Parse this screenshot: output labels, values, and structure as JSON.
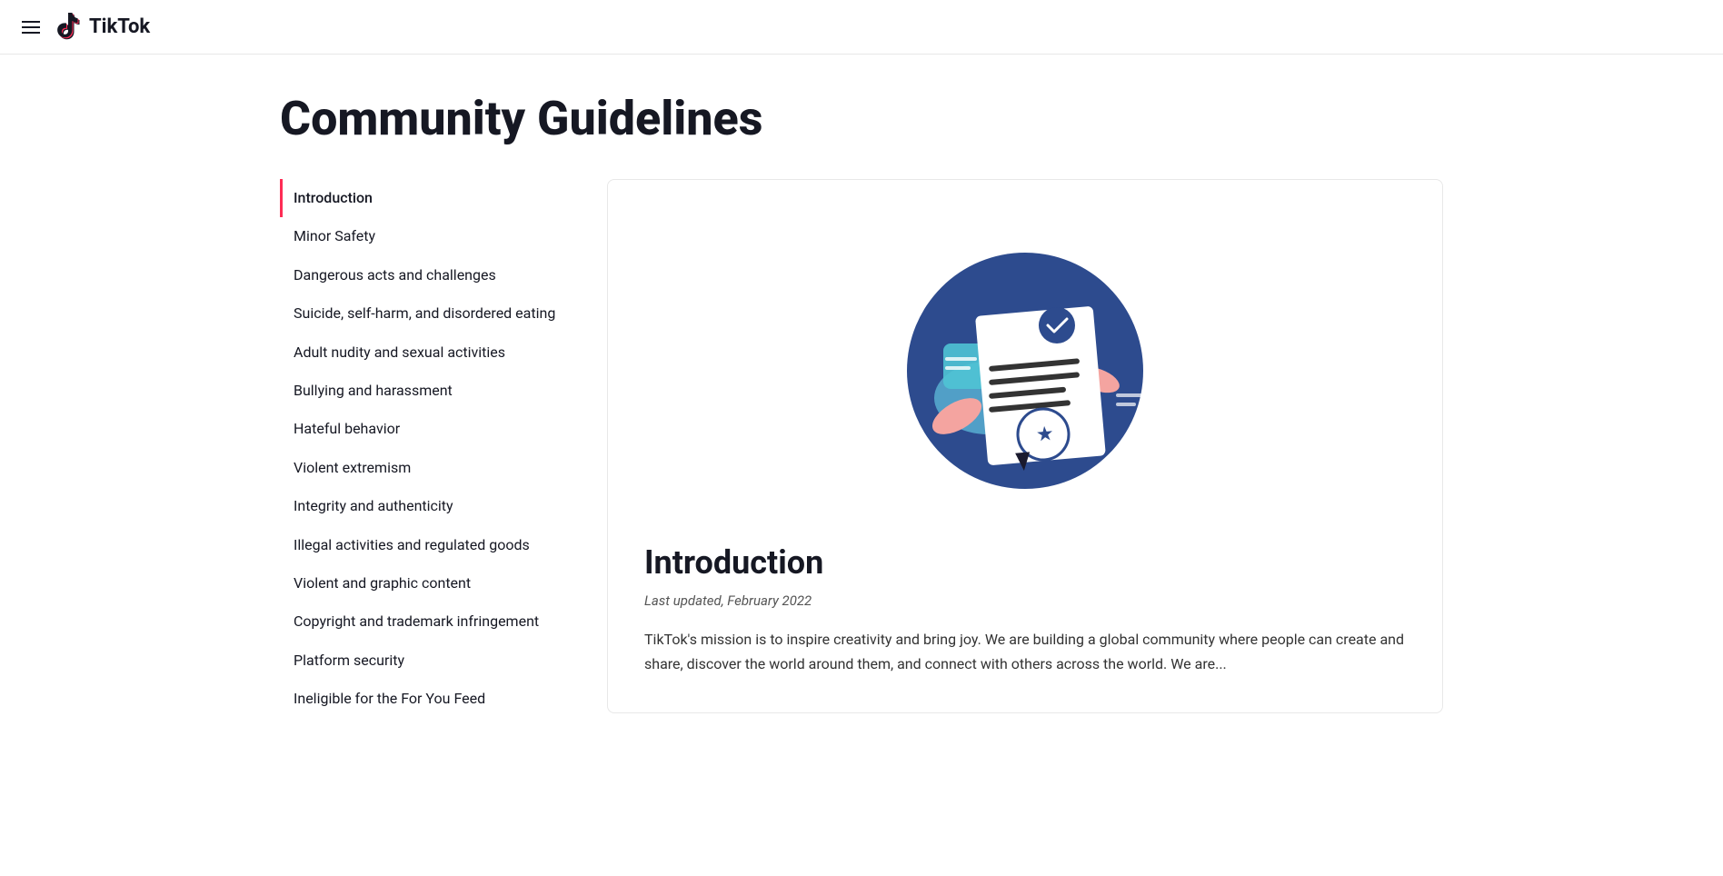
{
  "header": {
    "logo_text": "TikTok"
  },
  "page": {
    "title": "Community Guidelines"
  },
  "sidebar": {
    "items": [
      {
        "id": "introduction",
        "label": "Introduction",
        "active": true
      },
      {
        "id": "minor-safety",
        "label": "Minor Safety",
        "active": false
      },
      {
        "id": "dangerous-acts",
        "label": "Dangerous acts and challenges",
        "active": false
      },
      {
        "id": "suicide-self-harm",
        "label": "Suicide, self-harm, and disordered eating",
        "active": false
      },
      {
        "id": "adult-nudity",
        "label": "Adult nudity and sexual activities",
        "active": false
      },
      {
        "id": "bullying",
        "label": "Bullying and harassment",
        "active": false
      },
      {
        "id": "hateful-behavior",
        "label": "Hateful behavior",
        "active": false
      },
      {
        "id": "violent-extremism",
        "label": "Violent extremism",
        "active": false
      },
      {
        "id": "integrity",
        "label": "Integrity and authenticity",
        "active": false
      },
      {
        "id": "illegal-activities",
        "label": "Illegal activities and regulated goods",
        "active": false
      },
      {
        "id": "violent-graphic",
        "label": "Violent and graphic content",
        "active": false
      },
      {
        "id": "copyright",
        "label": "Copyright and trademark infringement",
        "active": false
      },
      {
        "id": "platform-security",
        "label": "Platform security",
        "active": false
      },
      {
        "id": "ineligible",
        "label": "Ineligible for the For You Feed",
        "active": false
      }
    ]
  },
  "content": {
    "section_title": "Introduction",
    "last_updated": "Last updated, February 2022",
    "intro_text": "TikTok's mission is to inspire creativity and bring joy. We are building a global community where people can create and share, discover the world around them, and connect with others across the world. We are..."
  }
}
